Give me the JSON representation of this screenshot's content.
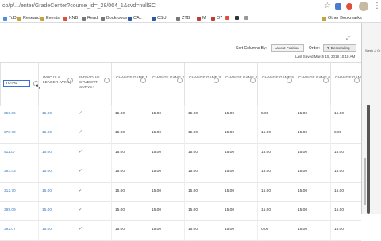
{
  "browser": {
    "url": "co/p/.../enter/GradeCenter?course_id=_28/064_1&cvd=nullSC",
    "icons": [
      "star-icon",
      "extension-icon",
      "extension2-icon",
      "profile-avatar",
      "menu-icon"
    ]
  },
  "bookmarks": [
    {
      "label": "ToDs",
      "color": "#4a90e2"
    },
    {
      "label": "Research",
      "color": "#c2a43b"
    },
    {
      "label": "Events",
      "color": "#c2a43b"
    },
    {
      "label": "KNB",
      "color": "#e04f3a"
    },
    {
      "label": "Read",
      "color": "#777777"
    },
    {
      "label": "Bookrooom",
      "color": "#777777"
    },
    {
      "label": "CAL",
      "color": "#2b58a8"
    },
    {
      "label": "CSU",
      "color": "#2b58a8"
    },
    {
      "label": "ZTB",
      "color": "#777777"
    },
    {
      "label": "M",
      "color": "#c23b3b"
    },
    {
      "label": "O7",
      "color": "#c23b3b"
    },
    {
      "label": "",
      "color": "#e04f3a"
    },
    {
      "label": "",
      "color": "#333333"
    },
    {
      "label": "",
      "color": "#999999"
    }
  ],
  "other_bookmarks": "Other Bookmarks",
  "toolbar": {
    "sort_label": "Sort Columns By:",
    "sort_value": "Layout Position",
    "order_label": "Order:",
    "order_value": "▼ Descending",
    "last_saved": "Last Saved:March 15, 2018 10:18 AM"
  },
  "columns": [
    {
      "label": ""
    },
    {
      "label": "WHO IS A LEADER (WK 1)"
    },
    {
      "label": "INDIVIDUAL STUDENT SURVEY"
    },
    {
      "label": "CHANGE GAME 1"
    },
    {
      "label": "CHANGE GAME 2"
    },
    {
      "label": "CHANGE GAME 3"
    },
    {
      "label": "CHANGE GAME 4"
    },
    {
      "label": "CHANGE GAME 5"
    },
    {
      "label": "CHANGE GAME 6"
    },
    {
      "label": "CHANGE GAME 7"
    }
  ],
  "total_label": "TOTAL",
  "rows": [
    [
      "350.06",
      "15.00",
      "✓",
      "15.00",
      "15.00",
      "15.00",
      "15.00",
      "5.00",
      "15.00",
      "15.00"
    ],
    [
      "378.70",
      "15.00",
      "✓",
      "15.00",
      "15.00",
      "15.00",
      "15.00",
      "15.00",
      "15.00",
      "6.00"
    ],
    [
      "411.07",
      "15.00",
      "✓",
      "15.00",
      "15.00",
      "15.00",
      "15.00",
      "15.00",
      "15.00",
      "15.00"
    ],
    [
      "383.43",
      "15.00",
      "✓",
      "15.00",
      "15.00",
      "15.00",
      "15.00",
      "15.00",
      "15.00",
      "15.00"
    ],
    [
      "312.70",
      "15.00",
      "✓",
      "15.00",
      "15.00",
      "15.00",
      "15.00",
      "15.00",
      "15.00",
      "15.00"
    ],
    [
      "395.09",
      "15.00",
      "✓",
      "15.00",
      "15.00",
      "15.00",
      "15.00",
      "15.00",
      "15.00",
      "15.00"
    ],
    [
      "392.07",
      "15.00",
      "✓",
      "15.00",
      "15.00",
      "15.00",
      "15.00",
      "0.00",
      "15.00",
      "15.00"
    ]
  ],
  "right_panel_label": "Week & Gr"
}
